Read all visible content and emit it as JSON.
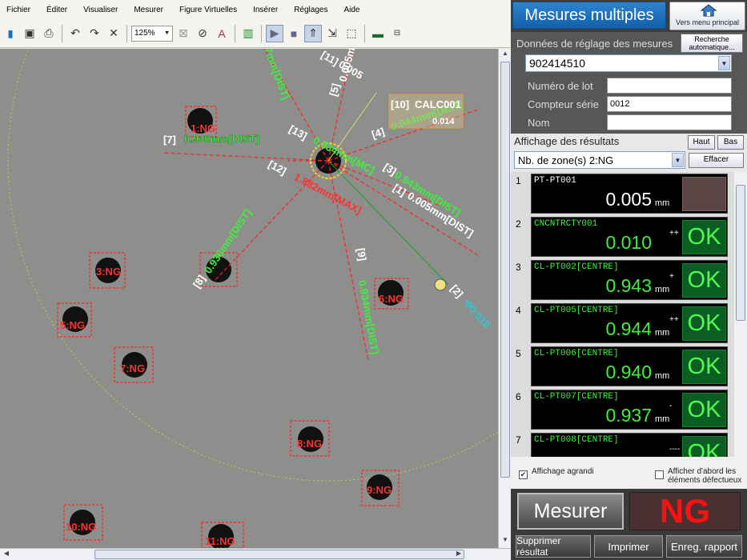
{
  "menu": [
    "Fichier",
    "Éditer",
    "Visualiser",
    "Mesurer",
    "Figure Virtuelles",
    "Insérer",
    "Réglages",
    "Aide"
  ],
  "toolbar": {
    "zoom": "125%"
  },
  "canvas": {
    "labels": {
      "zone1": "1:NG",
      "zone3": "3:NG",
      "zone5": "5:NG",
      "zone6": "6:NG",
      "zone7": "7:NG",
      "zone8": "8:NG",
      "zone9": "9:NG",
      "zone10": "10:NG",
      "zone11": "11:NG",
      "m7": "0.930mm[DIST]",
      "m7_id": "[7]",
      "m8": "0.936mm[DIST]",
      "m8_id": "[8]",
      "m9": "0.934mm[DIST]",
      "m9_id": "[9]",
      "m13": "0.934mm[MC]",
      "m13_id": "[13]",
      "m12": "1.882mm[MAX]",
      "m12_id": "[12]",
      "m3": "0.943mm[DIST]",
      "m3_id": "[3]",
      "m1": "0.005mm[DIST]",
      "m1_id": "[1]",
      "m4": "0.944mm[DIST]",
      "m4_id": "[4]",
      "m5": "0.005mm[DI",
      "m5_id": "[5]",
      "m11": "0.005",
      "m11_id": "[11]",
      "m10": "CALC001",
      "m10_id": "[10]",
      "m10_val": "0.014",
      "m2": "Φ0.010",
      "m2_id": "[2]",
      "mtop": "7mm[DIST]"
    }
  },
  "panel": {
    "title": "Mesures multiples",
    "home_button": "Vers menu principal",
    "settings_label": "Données de réglage des mesures",
    "auto_search": "Recherche automatique...",
    "program": "902414510",
    "lot_label": "Numéro de lot",
    "lot_value": "",
    "counter_label": "Compteur série",
    "counter_value": "0012",
    "name_label": "Nom",
    "name_value": "",
    "results_label": "Affichage des résultats",
    "btn_up": "Haut",
    "btn_down": "Bas",
    "zone_select": "Nb. de zone(s) 2:NG",
    "btn_clear": "Effacer",
    "rows": [
      {
        "num": "1",
        "name": "PT-PT001",
        "value": "0.005",
        "unit": "mm",
        "tol": "",
        "judge": ""
      },
      {
        "num": "2",
        "name": "CNCNTRCTY001",
        "value": "0.010",
        "unit": "",
        "tol": "++",
        "judge": "OK"
      },
      {
        "num": "3",
        "name": "CL-PT002[CENTRE]",
        "value": "0.943",
        "unit": "mm",
        "tol": "+",
        "judge": "OK"
      },
      {
        "num": "4",
        "name": "CL-PT005[CENTRE]",
        "value": "0.944",
        "unit": "mm",
        "tol": "++",
        "judge": "OK"
      },
      {
        "num": "5",
        "name": "CL-PT006[CENTRE]",
        "value": "0.940",
        "unit": "mm",
        "tol": "",
        "judge": "OK"
      },
      {
        "num": "6",
        "name": "CL-PT007[CENTRE]",
        "value": "0.937",
        "unit": "mm",
        "tol": "-",
        "judge": "OK"
      },
      {
        "num": "7",
        "name": "CL-PT008[CENTRE]",
        "value": "",
        "unit": "",
        "tol": "----",
        "judge": "OK"
      }
    ],
    "opt_enlarged": "Affichage agrandi",
    "opt_defects_first": "Afficher d'abord les éléments défectueux",
    "measure_btn": "Mesurer",
    "result": "NG",
    "btn_delete": "Supprimer résultat",
    "btn_print": "Imprimer",
    "btn_save": "Enreg. rapport"
  }
}
